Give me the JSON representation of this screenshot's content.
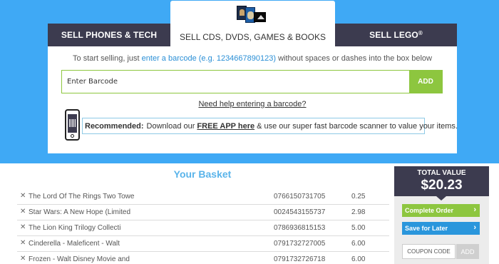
{
  "tabs": {
    "left": "SELL PHONES & TECH",
    "active": "SELL CDS, DVDS, GAMES & BOOKS",
    "right": "SELL LEGO",
    "right_mark": "®"
  },
  "instructions": {
    "prefix": "To start selling, just",
    "link": "enter a barcode (e.g. 1234667890123)",
    "suffix": "without spaces or dashes into the box below"
  },
  "barcode": {
    "placeholder": "Enter Barcode",
    "value": "",
    "add_label": "ADD"
  },
  "help_link": "Need help entering a barcode?",
  "recommend": {
    "label": "Recommended:",
    "text1": "Download our",
    "link": "FREE APP here",
    "text2": "& use our super fast barcode scanner to value your items."
  },
  "basket": {
    "title": "Your Basket",
    "items": [
      {
        "name": "The Lord Of The Rings Two Towe",
        "barcode": "0766150731705",
        "price": "0.25"
      },
      {
        "name": "Star Wars: A New Hope (Limited",
        "barcode": "0024543155737",
        "price": "2.98"
      },
      {
        "name": "The Lion King Trilogy Collecti",
        "barcode": "0786936815153",
        "price": "5.00"
      },
      {
        "name": "Cinderella - Maleficent - Walt",
        "barcode": "0791732727005",
        "price": "6.00"
      },
      {
        "name": "Frozen - Walt Disney Movie and",
        "barcode": "0791732726718",
        "price": "6.00"
      }
    ]
  },
  "sidebar": {
    "total_label": "TOTAL VALUE",
    "total_value": "$20.23",
    "complete_label": "Complete Order",
    "save_label": "Save for Later",
    "coupon_placeholder": "COUPON CODE",
    "coupon_add": "ADD"
  },
  "colors": {
    "hero": "#3fa9f5",
    "tab_dark": "#3c3b4f",
    "green": "#8dc63f",
    "blue_button": "#2a96dc",
    "title_blue": "#5ab4ea"
  }
}
